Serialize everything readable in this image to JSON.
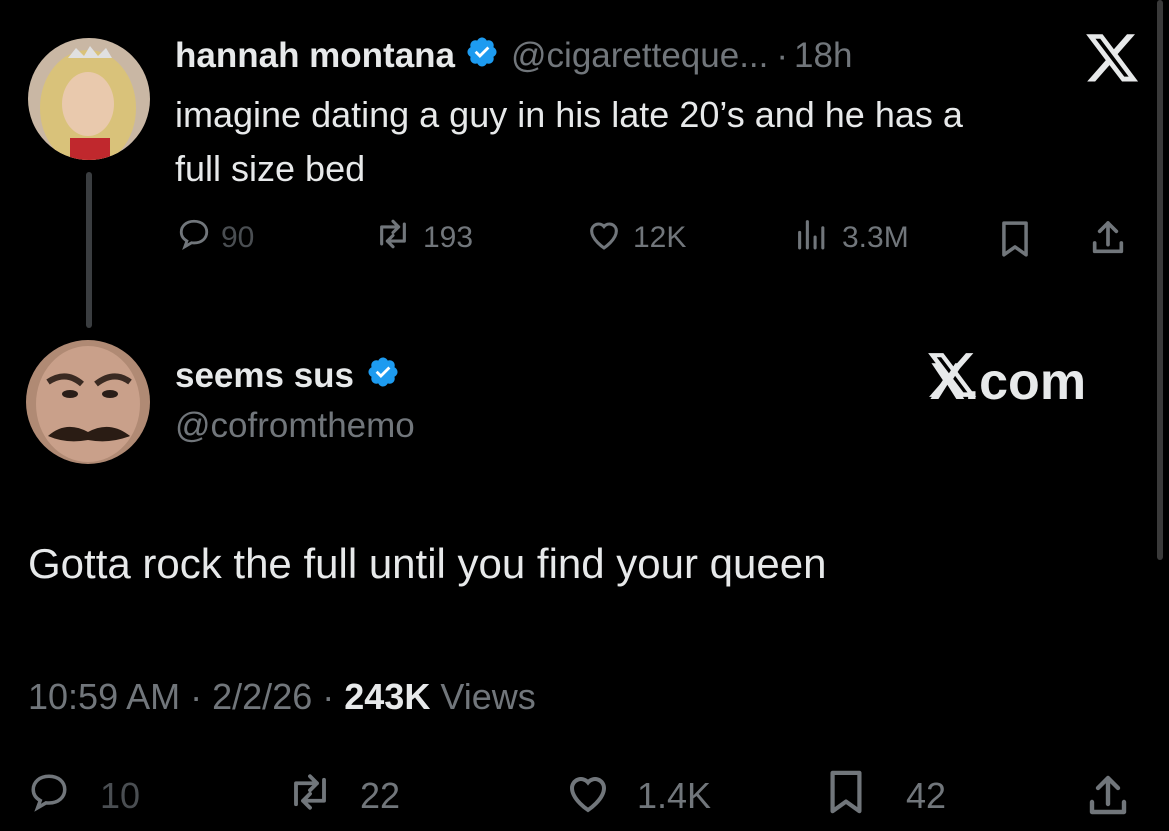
{
  "original_tweet": {
    "display_name": "hannah montana",
    "handle": "@cigaretteque...",
    "separator": "·",
    "time": "18h",
    "text_line1": "imagine dating a guy in his late 20’s and he has a",
    "text_line2": "full size bed",
    "metrics": {
      "replies": "90",
      "reposts": "193",
      "likes": "12K",
      "views": "3.3M"
    }
  },
  "reply_tweet": {
    "display_name": "seems sus",
    "handle": "@cofromthemo",
    "text": "Gotta rock the full until you find your queen",
    "time": "10:59 AM",
    "sep1": "·",
    "date": "2/2/26",
    "sep2": "·",
    "views_count": "243K",
    "views_label": "Views",
    "metrics": {
      "replies": "10",
      "reposts": "22",
      "likes": "1.4K",
      "bookmarks": "42"
    }
  },
  "branding": {
    "x_com_label": "X.com"
  },
  "colors": {
    "background": "#000000",
    "text": "#e7e9ea",
    "muted": "#71767b",
    "verified": "#1d9bf0"
  },
  "icons": [
    "x-logo-icon",
    "verified-badge-icon",
    "reply-icon",
    "repost-icon",
    "like-icon",
    "views-icon",
    "bookmark-icon",
    "share-icon"
  ]
}
